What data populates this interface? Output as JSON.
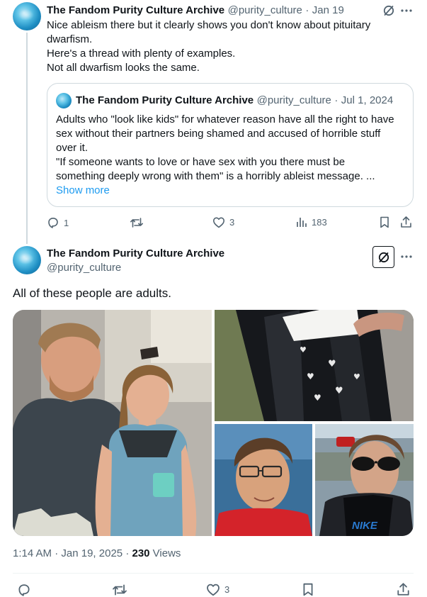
{
  "reply_tweet": {
    "author_name": "The Fandom Purity Culture Archive",
    "handle": "@purity_culture",
    "separator": "·",
    "date": "Jan 19",
    "text_lines": [
      "Nice ableism there but it clearly shows you don't know about pituitary",
      "dwarfism.",
      "Here's a thread with plenty of examples.",
      "Not all dwarfism looks the same."
    ],
    "quoted": {
      "author_name": "The Fandom Purity Culture Archive",
      "handle": "@purity_culture",
      "separator": "·",
      "date": "Jul 1, 2024",
      "text_lines": [
        "Adults who \"look like kids\" for whatever reason have all the right to have",
        "sex without their partners being shamed and accused of horrible stuff",
        "over it.",
        "\"If someone wants to love or have sex with you there must be",
        "something deeply wrong with them\" is a horribly ableist message. ..."
      ],
      "show_more": "Show more"
    },
    "actions": {
      "replies": "1",
      "likes": "3",
      "views": "183"
    }
  },
  "main_tweet": {
    "author_name": "The Fandom Purity Culture Archive",
    "handle": "@purity_culture",
    "text": "All of these people are adults.",
    "time": "1:14 AM",
    "separator": "·",
    "date": "Jan 19, 2025",
    "separator2": "·",
    "views_count": "230",
    "views_label": " Views",
    "actions": {
      "likes": "3"
    }
  },
  "photo_text": {
    "jacket_brand": "NIKE"
  },
  "icons": [
    "grok-icon",
    "more-icon",
    "reply-icon",
    "retweet-icon",
    "like-icon",
    "views-icon",
    "bookmark-icon",
    "share-icon"
  ],
  "colors": {
    "text": "#0f1419",
    "muted": "#536471",
    "link": "#1d9bf0",
    "border": "#cfd9de"
  }
}
